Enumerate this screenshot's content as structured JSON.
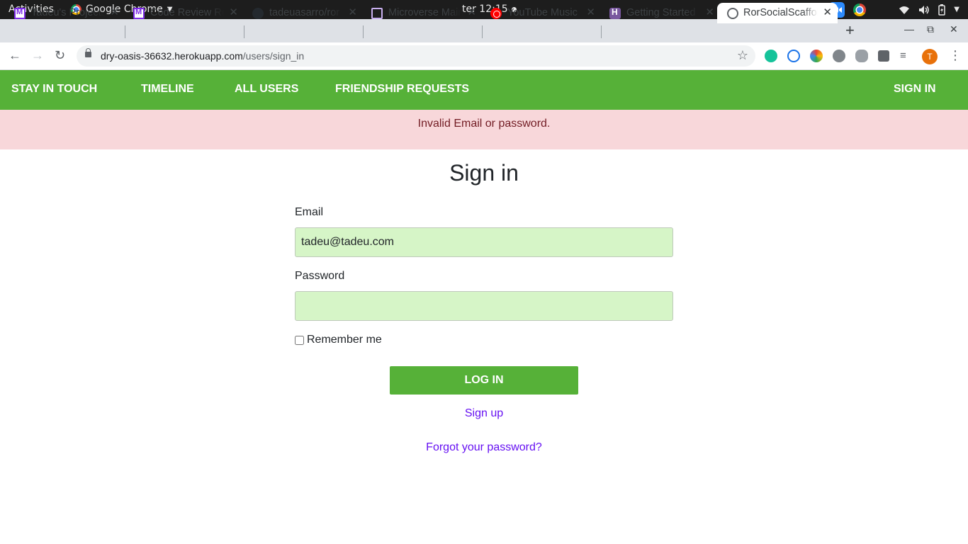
{
  "system": {
    "activities": "Activities",
    "app_name": "Google Chrome",
    "clock": "ter 12:15"
  },
  "tabs": [
    {
      "title": "Tadeu's Projects",
      "icon": "microverse-icon"
    },
    {
      "title": "Code Review Request",
      "icon": "microverse-icon"
    },
    {
      "title": "tadeuasarro/ror",
      "icon": "github-icon"
    },
    {
      "title": "Microverse Main",
      "icon": "microverse-icon"
    },
    {
      "title": "YouTube Music",
      "icon": "youtube-music-icon"
    },
    {
      "title": "Getting Started",
      "icon": "heroku-icon"
    },
    {
      "title": "RorSocialScaffold",
      "icon": "globe-icon",
      "active": true
    }
  ],
  "browser": {
    "url_host": "dry-oasis-36632.herokuapp.com",
    "url_path": "/users/sign_in",
    "profile_initial": "T"
  },
  "nav": {
    "brand": "STAY IN TOUCH",
    "timeline": "TIMELINE",
    "all_users": "ALL USERS",
    "friendship_requests": "FRIENDSHIP REQUESTS",
    "sign_in": "SIGN IN"
  },
  "alert": {
    "message": "Invalid Email or password."
  },
  "form": {
    "title": "Sign in",
    "email_label": "Email",
    "email_value": "tadeu@tadeu.com",
    "password_label": "Password",
    "password_value": "",
    "remember_label": "Remember me",
    "submit_label": "LOG IN",
    "signup_link": "Sign up",
    "forgot_link": "Forgot your password?"
  },
  "colors": {
    "navbar": "#56b138",
    "alert_bg": "#f8d7da",
    "alert_text": "#721c24",
    "input_bg": "#d6f5c7",
    "link": "#6610f2"
  }
}
